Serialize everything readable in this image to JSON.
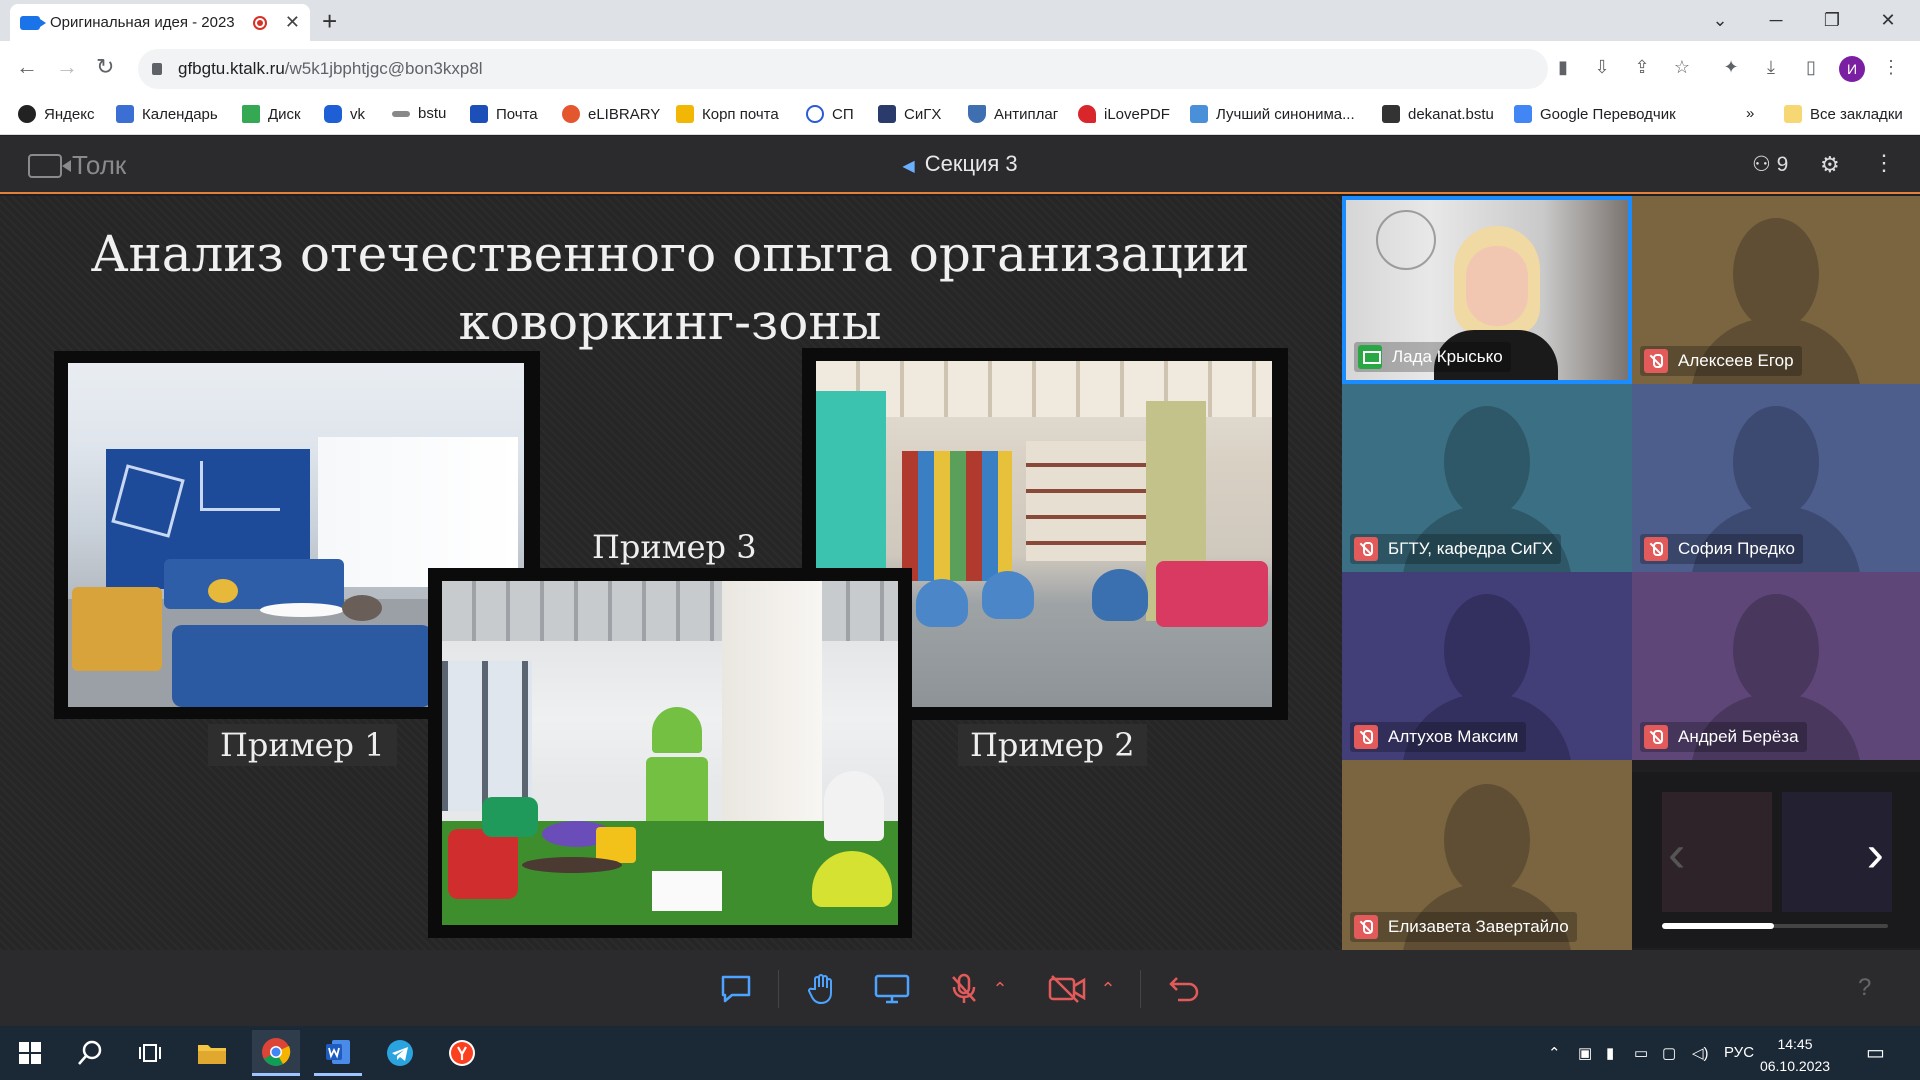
{
  "browser": {
    "tab_title": "Оригинальная идея - 2023",
    "url_host": "gfbgtu.ktalk.ru",
    "url_path": "/w5k1jbphtjgc@bon3kxp8l",
    "profile_initial": "И",
    "bookmarks": [
      "Яндекс",
      "Календарь",
      "Диск",
      "vk",
      "bstu",
      "Почта",
      "eLIBRARY",
      "Корп почта",
      "СП",
      "СиГХ",
      "Антиплаг",
      "iLovePDF",
      "Лучший синонима...",
      "dekanat.bstu",
      "Google Переводчик"
    ],
    "overflow": "»",
    "all_bookmarks": "Все закладки"
  },
  "app": {
    "logo_text": "Толк",
    "section_title": "Секция 3",
    "participants_count": "9"
  },
  "slide": {
    "title_line1": "Анализ отечественного опыта организации",
    "title_line2": "коворкинг-зоны",
    "captions": [
      "Пример 1",
      "Пример 2",
      "Пример 3"
    ]
  },
  "participants": [
    {
      "name": "Лада Крысько",
      "status": "screen-share",
      "bg": "#3b3b3b"
    },
    {
      "name": "Алексеев Егор",
      "status": "muted",
      "bg": "#7a6540"
    },
    {
      "name": "БГТУ, кафедра СиГХ",
      "status": "muted",
      "bg": "#3b7084"
    },
    {
      "name": "София Предко",
      "status": "muted",
      "bg": "#4d5d8c"
    },
    {
      "name": "Алтухов Максим",
      "status": "muted",
      "bg": "#423e78"
    },
    {
      "name": "Андрей Берёза",
      "status": "muted",
      "bg": "#5e4778"
    },
    {
      "name": "Елизавета Завертайло",
      "status": "muted",
      "bg": "#7a6540"
    }
  ],
  "colors": {
    "accent": "#e1813b",
    "muted_red": "#e35a5a",
    "active_border": "#1a8cff"
  },
  "taskbar": {
    "lang": "РУС",
    "time": "14:45",
    "date": "06.10.2023"
  }
}
